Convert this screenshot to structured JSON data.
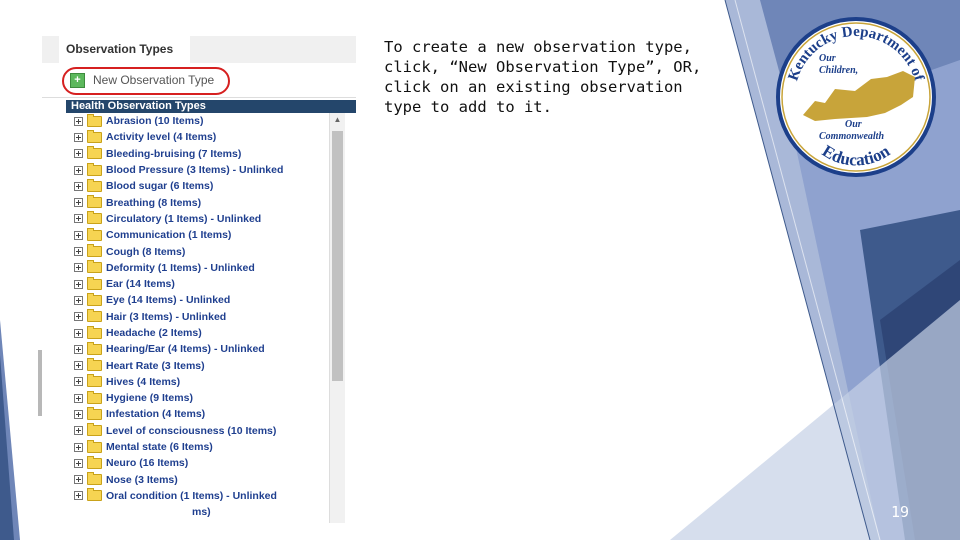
{
  "screenshot": {
    "tab_title": "Observation Types",
    "new_button_label": "New Observation Type",
    "panel_header": "Health Observation Types",
    "tree_items": [
      "Abrasion (10 Items)",
      "Activity level (4 Items)",
      "Bleeding-bruising (7 Items)",
      "Blood Pressure (3 Items) - Unlinked",
      "Blood sugar (6 Items)",
      "Breathing (8 Items)",
      "Circulatory (1 Items) - Unlinked",
      "Communication (1 Items)",
      "Cough (8 Items)",
      "Deformity (1 Items) - Unlinked",
      "Ear (14 Items)",
      "Eye (14 Items) - Unlinked",
      "Hair (3 Items) - Unlinked",
      "Headache (2 Items)",
      "Hearing/Ear (4 Items) - Unlinked",
      "Heart Rate (3 Items)",
      "Hives (4 Items)",
      "Hygiene (9 Items)",
      "Infestation (4 Items)",
      "Level of consciousness (10 Items)",
      "Mental state (6 Items)",
      "Neuro (16 Items)",
      "Nose (3 Items)",
      "Oral condition (1 Items) - Unlinked"
    ],
    "partial_item": "ms)"
  },
  "caption": "To create a new observation type, click, “New Observation Type”, OR, click on an existing observation type to add to it.",
  "logo": {
    "top_text": "Kentucky Department of",
    "middle_text_1": "Our",
    "middle_text_2": "Children,",
    "middle_text_3": "Our",
    "middle_text_4": "Commonwealth",
    "bottom_text": "Education"
  },
  "page_number": "19",
  "colors": {
    "slide_blue_dark": "#3e5a8c",
    "slide_blue_mid": "#6f86b8",
    "slide_blue_light": "#a9b8d8",
    "logo_blue": "#1c3f8a",
    "logo_gold": "#c8a43a",
    "highlight_red": "#d62020"
  }
}
